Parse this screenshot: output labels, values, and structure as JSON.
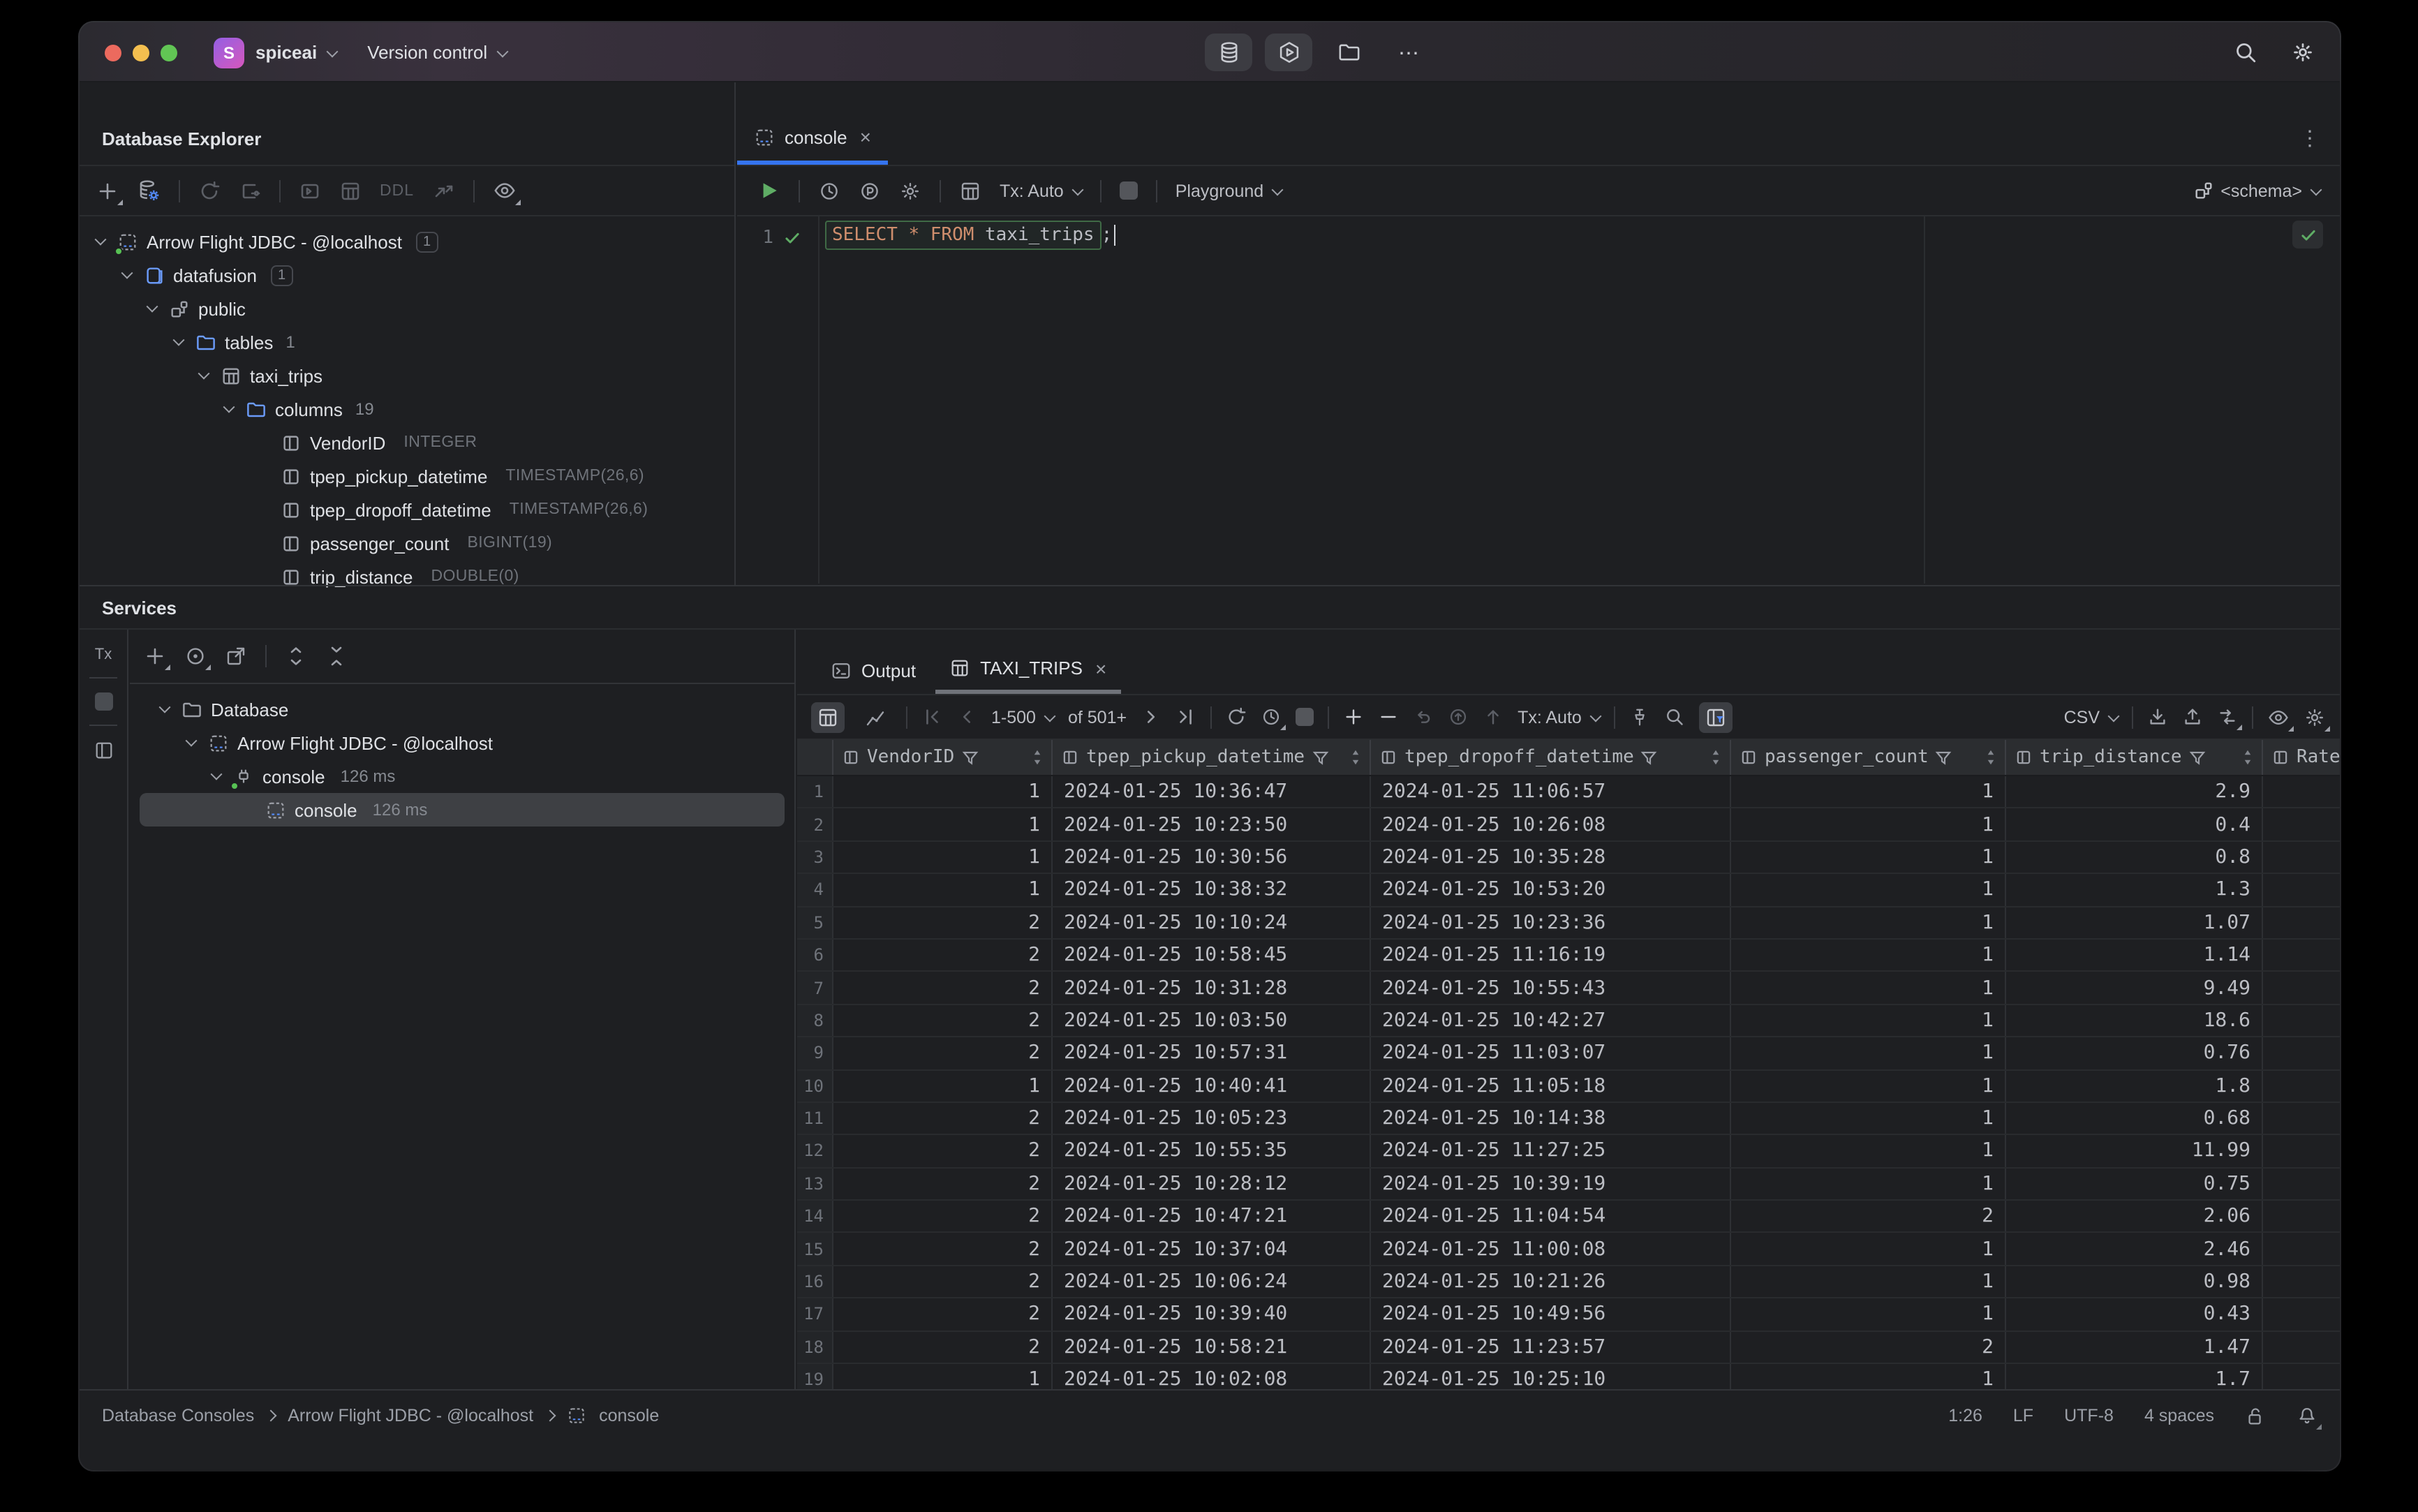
{
  "titlebar": {
    "project": "spiceai",
    "project_initial": "S",
    "version_control": "Version control"
  },
  "icons": {
    "close": "×",
    "kebab": "⋮",
    "ellipsis": "⋯"
  },
  "explorer": {
    "title": "Database Explorer",
    "toolbar": {
      "ddl_label": "DDL"
    },
    "tree": [
      {
        "label": "Arrow Flight JDBC - @localhost",
        "badge": "1"
      },
      {
        "label": "datafusion",
        "badge": "1"
      },
      {
        "label": "public"
      },
      {
        "label": "tables",
        "count": "1"
      },
      {
        "label": "taxi_trips"
      },
      {
        "label": "columns",
        "count": "19"
      },
      {
        "label": "VendorID",
        "type": "INTEGER"
      },
      {
        "label": "tpep_pickup_datetime",
        "type": "TIMESTAMP(26,6)"
      },
      {
        "label": "tpep_dropoff_datetime",
        "type": "TIMESTAMP(26,6)"
      },
      {
        "label": "passenger_count",
        "type": "BIGINT(19)"
      },
      {
        "label": "trip_distance",
        "type": "DOUBLE(0)"
      }
    ]
  },
  "editor": {
    "tab_label": "console",
    "toolbar": {
      "tx": "Tx: Auto",
      "playground": "Playground",
      "schema": "<schema>"
    },
    "line_number": "1",
    "sql": {
      "kw1": "SELECT",
      "star": "*",
      "kw2": "FROM",
      "table": "taxi_trips",
      "semi": ";"
    }
  },
  "services": {
    "title": "Services",
    "strip_tx": "Tx",
    "tree": [
      {
        "label": "Database"
      },
      {
        "label": "Arrow Flight JDBC - @localhost"
      },
      {
        "label": "console",
        "time": "126 ms"
      },
      {
        "label": "console",
        "time": "126 ms"
      }
    ]
  },
  "results": {
    "tabs": {
      "output": "Output",
      "table": "TAXI_TRIPS"
    },
    "toolbar": {
      "page_range": "1-500",
      "of_total": "of 501+",
      "tx": "Tx: Auto",
      "format": "CSV"
    },
    "columns": [
      "VendorID",
      "tpep_pickup_datetime",
      "tpep_dropoff_datetime",
      "passenger_count",
      "trip_distance",
      "Rate"
    ],
    "rows": [
      [
        "1",
        "1",
        "2024-01-25 10:36:47",
        "2024-01-25 11:06:57",
        "1",
        "2.9"
      ],
      [
        "2",
        "1",
        "2024-01-25 10:23:50",
        "2024-01-25 10:26:08",
        "1",
        "0.4"
      ],
      [
        "3",
        "1",
        "2024-01-25 10:30:56",
        "2024-01-25 10:35:28",
        "1",
        "0.8"
      ],
      [
        "4",
        "1",
        "2024-01-25 10:38:32",
        "2024-01-25 10:53:20",
        "1",
        "1.3"
      ],
      [
        "5",
        "2",
        "2024-01-25 10:10:24",
        "2024-01-25 10:23:36",
        "1",
        "1.07"
      ],
      [
        "6",
        "2",
        "2024-01-25 10:58:45",
        "2024-01-25 11:16:19",
        "1",
        "1.14"
      ],
      [
        "7",
        "2",
        "2024-01-25 10:31:28",
        "2024-01-25 10:55:43",
        "1",
        "9.49"
      ],
      [
        "8",
        "2",
        "2024-01-25 10:03:50",
        "2024-01-25 10:42:27",
        "1",
        "18.6"
      ],
      [
        "9",
        "2",
        "2024-01-25 10:57:31",
        "2024-01-25 11:03:07",
        "1",
        "0.76"
      ],
      [
        "10",
        "1",
        "2024-01-25 10:40:41",
        "2024-01-25 11:05:18",
        "1",
        "1.8"
      ],
      [
        "11",
        "2",
        "2024-01-25 10:05:23",
        "2024-01-25 10:14:38",
        "1",
        "0.68"
      ],
      [
        "12",
        "2",
        "2024-01-25 10:55:35",
        "2024-01-25 11:27:25",
        "1",
        "11.99"
      ],
      [
        "13",
        "2",
        "2024-01-25 10:28:12",
        "2024-01-25 10:39:19",
        "1",
        "0.75"
      ],
      [
        "14",
        "2",
        "2024-01-25 10:47:21",
        "2024-01-25 11:04:54",
        "2",
        "2.06"
      ],
      [
        "15",
        "2",
        "2024-01-25 10:37:04",
        "2024-01-25 11:00:08",
        "1",
        "2.46"
      ],
      [
        "16",
        "2",
        "2024-01-25 10:06:24",
        "2024-01-25 10:21:26",
        "1",
        "0.98"
      ],
      [
        "17",
        "2",
        "2024-01-25 10:39:40",
        "2024-01-25 10:49:56",
        "1",
        "0.43"
      ],
      [
        "18",
        "2",
        "2024-01-25 10:58:21",
        "2024-01-25 11:23:57",
        "2",
        "1.47"
      ],
      [
        "19",
        "1",
        "2024-01-25 10:02:08",
        "2024-01-25 10:25:10",
        "1",
        "1.7"
      ]
    ]
  },
  "statusbar": {
    "breadcrumb": [
      "Database Consoles",
      "Arrow Flight JDBC - @localhost",
      "console"
    ],
    "cursor": "1:26",
    "line_ending": "LF",
    "encoding": "UTF-8",
    "indent": "4 spaces"
  }
}
